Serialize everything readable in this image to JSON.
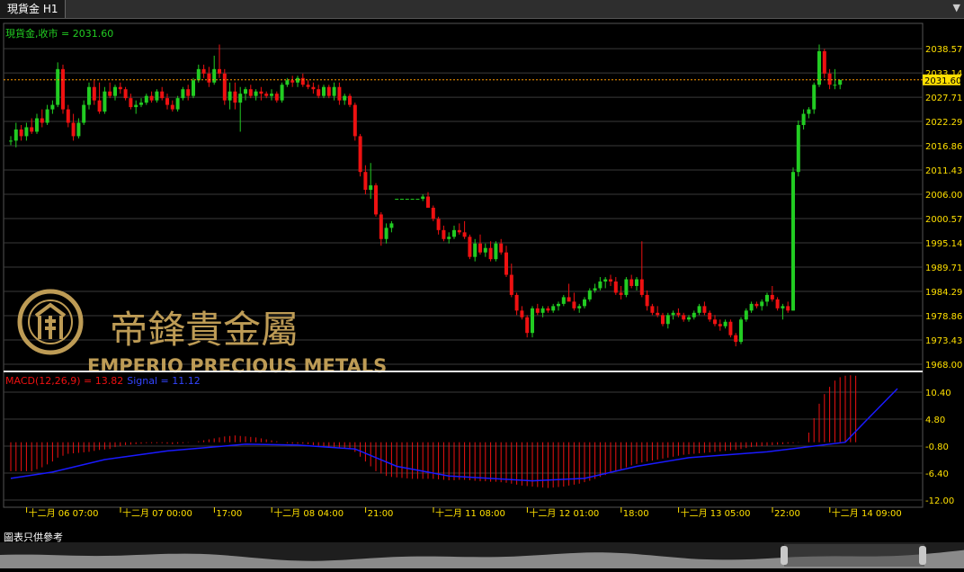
{
  "window": {
    "tab_title": "現貨金 H1"
  },
  "legend": {
    "price": "現貨金,收市 = 2031.60",
    "macd": "MACD(12,26,9) = 13.82",
    "signal": "Signal = 11.12"
  },
  "colors": {
    "up": "#22cc22",
    "down": "#ee1111",
    "grid": "#3a3a3a",
    "axis_text": "#ffe000",
    "price_line": "#ff9900",
    "signal": "#1a1aff",
    "hist": "#ee1111",
    "label_green": "#22cc22"
  },
  "watermark": {
    "chinese": "帝鋒貴金屬",
    "english": "EMPERIO PRECIOUS METALS"
  },
  "footnote": "圖表只供參考",
  "chart_data": [
    {
      "type": "candlestick",
      "title": "現貨金 H1",
      "ylim": [
        1968.0,
        2040.0
      ],
      "y_ticks": [
        "2038.57",
        "2033.14",
        "2027.71",
        "2022.29",
        "2016.86",
        "2011.43",
        "2006.00",
        "2000.57",
        "1995.14",
        "1989.71",
        "1984.29",
        "1978.86",
        "1973.43",
        "1968.00"
      ],
      "current_price": 2031.6,
      "current_price_label": "2031.60",
      "x_labels": [
        "十二月 06 07:00",
        "十二月 07 00:00",
        "17:00",
        "十二月 08 04:00",
        "21:00",
        "十二月 11 08:00",
        "十二月 12 01:00",
        "18:00",
        "十二月 13 05:00",
        "22:00",
        "十二月 14 09:00"
      ],
      "x_label_positions": [
        2,
        20,
        38,
        49,
        67,
        80,
        98,
        116,
        127,
        145,
        156
      ],
      "ohlc": [
        [
          2018.0,
          2019.0,
          2017.0,
          2018.0
        ],
        [
          2018.0,
          2022.0,
          2016.5,
          2020.5
        ],
        [
          2020.5,
          2021.5,
          2018.0,
          2019.0
        ],
        [
          2019.0,
          2022.0,
          2018.0,
          2021.0
        ],
        [
          2021.0,
          2023.0,
          2019.5,
          2020.0
        ],
        [
          2020.0,
          2024.0,
          2019.5,
          2023.0
        ],
        [
          2023.0,
          2025.0,
          2021.0,
          2022.0
        ],
        [
          2022.0,
          2026.0,
          2021.5,
          2025.0
        ],
        [
          2025.0,
          2027.0,
          2024.0,
          2026.0
        ],
        [
          2026.0,
          2035.5,
          2025.5,
          2034.0
        ],
        [
          2034.0,
          2035.0,
          2024.0,
          2025.0
        ],
        [
          2025.0,
          2026.0,
          2021.0,
          2022.0
        ],
        [
          2022.0,
          2024.0,
          2018.0,
          2019.0
        ],
        [
          2019.0,
          2023.0,
          2018.5,
          2022.0
        ],
        [
          2022.0,
          2027.0,
          2021.5,
          2026.0
        ],
        [
          2026.0,
          2031.0,
          2025.0,
          2030.0
        ],
        [
          2030.0,
          2031.5,
          2026.0,
          2027.0
        ],
        [
          2027.0,
          2031.0,
          2024.0,
          2024.5
        ],
        [
          2024.5,
          2030.0,
          2024.0,
          2029.0
        ],
        [
          2029.0,
          2031.0,
          2027.5,
          2028.0
        ],
        [
          2028.0,
          2030.5,
          2027.0,
          2030.0
        ],
        [
          2030.0,
          2031.0,
          2028.5,
          2029.5
        ],
        [
          2029.5,
          2030.0,
          2027.0,
          2027.5
        ],
        [
          2027.5,
          2028.5,
          2025.0,
          2025.5
        ],
        [
          2025.5,
          2027.0,
          2024.0,
          2026.0
        ],
        [
          2026.0,
          2027.5,
          2025.5,
          2026.5
        ],
        [
          2026.5,
          2028.5,
          2026.0,
          2028.0
        ],
        [
          2028.0,
          2029.0,
          2026.5,
          2027.0
        ],
        [
          2027.0,
          2029.5,
          2026.5,
          2029.0
        ],
        [
          2029.0,
          2030.0,
          2027.0,
          2027.5
        ],
        [
          2027.5,
          2028.5,
          2025.0,
          2026.0
        ],
        [
          2026.0,
          2027.0,
          2024.5,
          2025.0
        ],
        [
          2025.0,
          2028.0,
          2024.5,
          2027.5
        ],
        [
          2027.5,
          2030.0,
          2027.0,
          2029.5
        ],
        [
          2029.5,
          2030.5,
          2027.0,
          2028.0
        ],
        [
          2028.0,
          2032.0,
          2027.5,
          2031.5
        ],
        [
          2031.5,
          2035.0,
          2031.0,
          2034.0
        ],
        [
          2034.0,
          2035.0,
          2032.0,
          2033.0
        ],
        [
          2033.0,
          2034.5,
          2030.0,
          2031.0
        ],
        [
          2031.0,
          2037.0,
          2030.5,
          2034.0
        ],
        [
          2034.0,
          2039.5,
          2032.0,
          2033.0
        ],
        [
          2033.0,
          2034.0,
          2026.0,
          2027.0
        ],
        [
          2027.0,
          2031.0,
          2025.0,
          2029.0
        ],
        [
          2029.0,
          2031.0,
          2025.0,
          2026.5
        ],
        [
          2026.5,
          2030.0,
          2020.0,
          2028.5
        ],
        [
          2028.5,
          2030.0,
          2027.0,
          2029.5
        ],
        [
          2029.5,
          2030.5,
          2027.5,
          2028.0
        ],
        [
          2028.0,
          2029.5,
          2027.0,
          2029.0
        ],
        [
          2029.0,
          2030.0,
          2027.0,
          2028.5
        ],
        [
          2028.5,
          2029.0,
          2027.5,
          2028.0
        ],
        [
          2028.0,
          2029.5,
          2027.0,
          2028.5
        ],
        [
          2028.5,
          2029.0,
          2026.5,
          2027.0
        ],
        [
          2027.0,
          2031.0,
          2026.5,
          2030.5
        ],
        [
          2030.5,
          2032.0,
          2030.0,
          2031.5
        ],
        [
          2031.5,
          2032.5,
          2030.0,
          2031.0
        ],
        [
          2031.0,
          2032.5,
          2030.0,
          2032.0
        ],
        [
          2032.0,
          2033.0,
          2030.0,
          2030.5
        ],
        [
          2030.5,
          2031.5,
          2029.5,
          2030.0
        ],
        [
          2030.0,
          2031.0,
          2028.5,
          2029.5
        ],
        [
          2029.5,
          2030.5,
          2027.5,
          2028.0
        ],
        [
          2028.0,
          2030.5,
          2027.5,
          2030.0
        ],
        [
          2030.0,
          2030.5,
          2027.5,
          2028.0
        ],
        [
          2028.0,
          2031.0,
          2027.0,
          2030.0
        ],
        [
          2030.0,
          2031.0,
          2026.0,
          2027.0
        ],
        [
          2027.0,
          2028.5,
          2026.0,
          2028.0
        ],
        [
          2028.0,
          2028.5,
          2025.5,
          2026.0
        ],
        [
          2026.0,
          2026.5,
          2018.0,
          2019.0
        ],
        [
          2019.0,
          2019.5,
          2010.0,
          2011.0
        ],
        [
          2011.0,
          2012.5,
          2006.0,
          2007.0
        ],
        [
          2007.0,
          2013.0,
          2005.0,
          2008.0
        ],
        [
          2008.0,
          2008.5,
          2001.0,
          2001.5
        ],
        [
          2001.5,
          2002.0,
          1994.5,
          1996.0
        ],
        [
          1996.0,
          1999.5,
          1995.0,
          1998.5
        ],
        [
          1998.5,
          2000.0,
          1997.5,
          1999.5
        ],
        [
          2005.0,
          2005.0,
          2005.0,
          2005.0
        ],
        [
          2005.0,
          2005.0,
          2005.0,
          2005.0
        ],
        [
          2005.0,
          2005.0,
          2005.0,
          2005.0
        ],
        [
          2005.0,
          2005.0,
          2005.0,
          2005.0
        ],
        [
          2005.0,
          2005.0,
          2005.0,
          2005.0
        ],
        [
          2005.0,
          2006.0,
          2004.5,
          2005.5
        ],
        [
          2005.5,
          2006.5,
          2003.0,
          2003.0
        ],
        [
          2003.0,
          2003.5,
          2000.0,
          2000.5
        ],
        [
          2000.5,
          2001.0,
          1997.0,
          1998.0
        ],
        [
          1998.0,
          1999.0,
          1995.5,
          1996.0
        ],
        [
          1996.0,
          1997.5,
          1995.0,
          1996.5
        ],
        [
          1996.5,
          1999.0,
          1996.0,
          1998.0
        ],
        [
          1998.0,
          1999.5,
          1997.0,
          1997.5
        ],
        [
          1997.5,
          2000.0,
          1996.0,
          1996.5
        ],
        [
          1996.5,
          1997.0,
          1991.5,
          1992.0
        ],
        [
          1992.0,
          1996.0,
          1991.0,
          1995.0
        ],
        [
          1995.0,
          1997.0,
          1992.5,
          1993.0
        ],
        [
          1993.0,
          1995.0,
          1992.0,
          1994.0
        ],
        [
          1994.0,
          1995.5,
          1991.0,
          1991.5
        ],
        [
          1991.5,
          1995.5,
          1991.0,
          1995.0
        ],
        [
          1995.0,
          1996.0,
          1992.5,
          1993.0
        ],
        [
          1993.0,
          1994.5,
          1987.5,
          1988.0
        ],
        [
          1988.0,
          1990.5,
          1983.0,
          1983.5
        ],
        [
          1983.5,
          1984.0,
          1979.0,
          1980.0
        ],
        [
          1980.0,
          1981.0,
          1978.0,
          1978.5
        ],
        [
          1978.5,
          1979.0,
          1974.0,
          1975.0
        ],
        [
          1975.0,
          1981.0,
          1974.0,
          1980.5
        ],
        [
          1980.5,
          1981.5,
          1979.0,
          1979.5
        ],
        [
          1979.5,
          1981.0,
          1978.5,
          1980.5
        ],
        [
          1980.5,
          1981.0,
          1979.5,
          1980.0
        ],
        [
          1980.0,
          1981.5,
          1979.5,
          1981.0
        ],
        [
          1981.0,
          1982.0,
          1980.0,
          1981.5
        ],
        [
          1981.5,
          1983.5,
          1981.0,
          1983.0
        ],
        [
          1983.0,
          1986.0,
          1982.5,
          1982.0
        ],
        [
          1982.0,
          1984.0,
          1980.0,
          1980.5
        ],
        [
          1980.5,
          1981.5,
          1979.5,
          1981.0
        ],
        [
          1981.0,
          1983.0,
          1980.5,
          1982.5
        ],
        [
          1982.5,
          1985.0,
          1982.0,
          1984.5
        ],
        [
          1984.5,
          1986.0,
          1984.0,
          1985.0
        ],
        [
          1985.0,
          1987.5,
          1984.5,
          1986.5
        ],
        [
          1986.5,
          1987.5,
          1985.0,
          1987.0
        ],
        [
          1987.0,
          1988.0,
          1985.5,
          1986.5
        ],
        [
          1986.5,
          1987.5,
          1983.5,
          1984.0
        ],
        [
          1984.0,
          1985.5,
          1982.5,
          1983.5
        ],
        [
          1983.5,
          1987.5,
          1983.0,
          1987.0
        ],
        [
          1987.0,
          1988.0,
          1985.0,
          1985.5
        ],
        [
          1985.5,
          1987.5,
          1984.5,
          1987.0
        ],
        [
          1987.0,
          1995.5,
          1983.0,
          1983.5
        ],
        [
          1983.5,
          1984.5,
          1980.0,
          1981.0
        ],
        [
          1981.0,
          1981.5,
          1979.0,
          1979.5
        ],
        [
          1979.5,
          1981.0,
          1978.5,
          1979.0
        ],
        [
          1979.0,
          1979.5,
          1976.5,
          1977.0
        ],
        [
          1977.0,
          1979.5,
          1976.0,
          1979.0
        ],
        [
          1979.0,
          1980.0,
          1978.0,
          1979.5
        ],
        [
          1979.5,
          1980.5,
          1978.5,
          1979.0
        ],
        [
          1979.0,
          1979.5,
          1977.5,
          1978.0
        ],
        [
          1978.0,
          1979.0,
          1977.5,
          1978.5
        ],
        [
          1978.5,
          1980.0,
          1978.0,
          1979.5
        ],
        [
          1979.5,
          1981.5,
          1979.0,
          1981.0
        ],
        [
          1981.0,
          1982.0,
          1979.0,
          1979.5
        ],
        [
          1979.5,
          1980.0,
          1977.5,
          1978.0
        ],
        [
          1978.0,
          1979.0,
          1976.5,
          1977.0
        ],
        [
          1977.0,
          1978.0,
          1975.5,
          1976.5
        ],
        [
          1976.5,
          1978.0,
          1976.0,
          1977.5
        ],
        [
          1977.5,
          1978.0,
          1974.0,
          1974.5
        ],
        [
          1974.5,
          1975.0,
          1972.0,
          1973.0
        ],
        [
          1973.0,
          1978.5,
          1972.5,
          1978.0
        ],
        [
          1978.0,
          1980.5,
          1977.5,
          1980.0
        ],
        [
          1980.0,
          1982.0,
          1979.5,
          1981.5
        ],
        [
          1981.5,
          1982.0,
          1980.5,
          1981.0
        ],
        [
          1981.0,
          1982.5,
          1980.0,
          1982.0
        ],
        [
          1982.0,
          1984.0,
          1981.0,
          1983.5
        ],
        [
          1983.5,
          1985.5,
          1982.0,
          1982.5
        ],
        [
          1982.5,
          1983.0,
          1980.0,
          1980.5
        ],
        [
          1980.5,
          1981.5,
          1978.0,
          1981.0
        ],
        [
          1981.0,
          1982.0,
          1979.5,
          1980.0
        ],
        [
          1980.0,
          2012.0,
          1980.0,
          2011.0
        ],
        [
          2011.0,
          2022.5,
          2010.0,
          2021.5
        ],
        [
          2021.5,
          2025.0,
          2020.5,
          2024.0
        ],
        [
          2024.0,
          2025.5,
          2023.0,
          2025.0
        ],
        [
          2025.0,
          2031.0,
          2024.0,
          2030.5
        ],
        [
          2030.5,
          2039.5,
          2030.0,
          2038.0
        ],
        [
          2038.0,
          2038.5,
          2032.0,
          2033.0
        ],
        [
          2033.0,
          2034.0,
          2029.5,
          2030.5
        ],
        [
          2030.5,
          2034.0,
          2029.5,
          2030.5
        ],
        [
          2030.5,
          2031.5,
          2029.5,
          2031.6
        ]
      ]
    },
    {
      "type": "bar",
      "title": "MACD(12,26,9)",
      "ylim": [
        -12.0,
        10.4
      ],
      "y_ticks": [
        "10.40",
        "4.80",
        "-0.80",
        "-6.40",
        "-12.00"
      ],
      "macd": [
        -6.0,
        -6.0,
        -6.0,
        -6.0,
        -6.0,
        -5.6,
        -5.2,
        -4.6,
        -4.0,
        -3.2,
        -2.8,
        -2.4,
        -2.3,
        -2.2,
        -2.1,
        -2.0,
        -1.8,
        -1.6,
        -1.5,
        -1.4,
        -1.0,
        -0.8,
        -0.6,
        -0.5,
        -0.4,
        -0.3,
        -0.2,
        -0.2,
        -0.2,
        -0.2,
        -0.3,
        -0.4,
        -0.3,
        -0.2,
        -0.1,
        0.0,
        0.2,
        0.4,
        0.6,
        0.8,
        1.0,
        1.2,
        1.3,
        1.4,
        1.3,
        1.2,
        1.1,
        1.0,
        0.8,
        0.6,
        0.4,
        0.2,
        0.0,
        -0.2,
        -0.3,
        -0.3,
        -0.3,
        -0.4,
        -0.6,
        -0.7,
        -0.8,
        -1.0,
        -1.1,
        -1.2,
        -1.3,
        -1.4,
        -2.0,
        -3.0,
        -4.0,
        -5.0,
        -6.0,
        -6.5,
        -7.0,
        -7.2,
        -7.3,
        -7.4,
        -7.5,
        -7.6,
        -7.6,
        -7.6,
        -7.6,
        -7.6,
        -7.7,
        -7.8,
        -7.9,
        -7.9,
        -7.8,
        -7.8,
        -7.9,
        -8.0,
        -8.1,
        -8.1,
        -8.2,
        -8.2,
        -8.3,
        -8.4,
        -8.6,
        -8.8,
        -9.0,
        -9.1,
        -9.2,
        -9.3,
        -9.4,
        -9.5,
        -9.4,
        -9.3,
        -9.2,
        -9.0,
        -8.8,
        -8.6,
        -8.3,
        -8.0,
        -7.6,
        -7.2,
        -6.8,
        -6.4,
        -6.0,
        -5.6,
        -5.2,
        -4.8,
        -4.5,
        -4.2,
        -4.0,
        -3.8,
        -3.6,
        -3.4,
        -3.2,
        -3.0,
        -2.8,
        -2.6,
        -2.5,
        -2.4,
        -2.3,
        -2.2,
        -2.1,
        -2.0,
        -1.9,
        -1.8,
        -1.7,
        -1.6,
        -1.4,
        -1.2,
        -1.0,
        -0.9,
        -0.8,
        -0.7,
        -0.6,
        -0.5,
        -0.4,
        -0.3,
        -0.2,
        -0.1,
        0.0,
        2.0,
        5.0,
        8.0,
        10.0,
        11.5,
        12.8,
        13.5,
        13.8,
        13.9,
        13.8
      ],
      "signal_keypoints": [
        [
          0,
          -7.5
        ],
        [
          8,
          -6.2
        ],
        [
          18,
          -3.6
        ],
        [
          30,
          -1.8
        ],
        [
          45,
          -0.4
        ],
        [
          55,
          -0.6
        ],
        [
          66,
          -1.4
        ],
        [
          74,
          -5.0
        ],
        [
          84,
          -7.0
        ],
        [
          100,
          -8.0
        ],
        [
          110,
          -7.5
        ],
        [
          120,
          -5.0
        ],
        [
          130,
          -3.2
        ],
        [
          145,
          -2.0
        ],
        [
          160,
          0.0
        ],
        [
          164,
          4.5
        ],
        [
          170,
          11.12
        ]
      ]
    }
  ]
}
